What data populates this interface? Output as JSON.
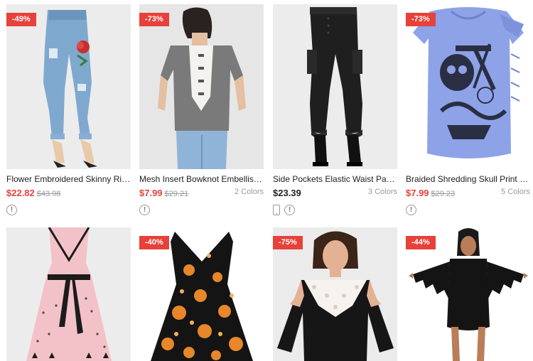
{
  "products": [
    {
      "discount": "-49%",
      "title": "Flower Embroidered Skinny Ripped Jeans",
      "price": "$22.82",
      "old_price": "$43.98",
      "colors": "",
      "image_icon": "jeans-image",
      "has_phone_icon": false
    },
    {
      "discount": "-73%",
      "title": "Mesh Insert Bowknot Embellished T-shirt",
      "price": "$7.99",
      "old_price": "$29.21",
      "colors": "2 Colors",
      "image_icon": "tshirt-back-image",
      "has_phone_icon": false
    },
    {
      "discount": "",
      "title": "Side Pockets Elastic Waist Pants",
      "price": "$23.39",
      "old_price": "",
      "colors": "3 Colors",
      "image_icon": "cargo-pants-image",
      "has_phone_icon": true
    },
    {
      "discount": "-73%",
      "title": "Braided Shredding Skull Print Graphic Tee",
      "price": "$7.99",
      "old_price": "$29.23",
      "colors": "5 Colors",
      "image_icon": "skull-tee-image",
      "has_phone_icon": false
    },
    {
      "discount": "",
      "title": "",
      "price": "",
      "old_price": "",
      "colors": "",
      "image_icon": "pink-wrap-dress-image",
      "has_phone_icon": false
    },
    {
      "discount": "-40%",
      "title": "",
      "price": "",
      "old_price": "",
      "colors": "",
      "image_icon": "floral-dress-image",
      "has_phone_icon": false
    },
    {
      "discount": "-75%",
      "title": "",
      "price": "",
      "old_price": "",
      "colors": "",
      "image_icon": "lace-top-image",
      "has_phone_icon": false
    },
    {
      "discount": "-44%",
      "title": "",
      "price": "",
      "old_price": "",
      "colors": "",
      "image_icon": "bat-wing-dress-image",
      "has_phone_icon": false
    }
  ],
  "info_icon_glyph": "!",
  "colors": {
    "accent": "#e8403a",
    "muted": "#999999",
    "text": "#222222"
  }
}
